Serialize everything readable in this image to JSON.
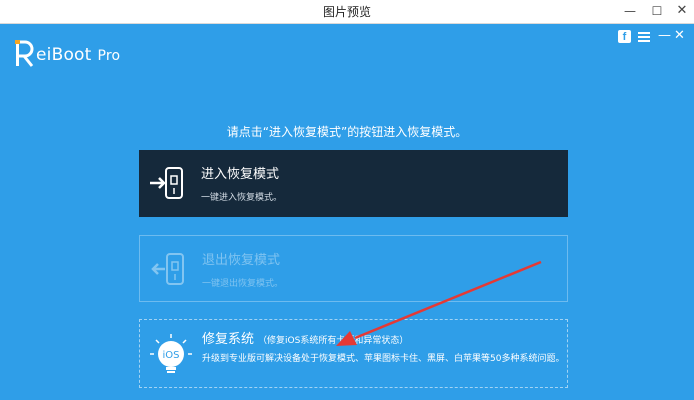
{
  "window": {
    "title": "图片预览",
    "min": "—",
    "max": "☐",
    "close": "✕"
  },
  "app": {
    "logo_name": "eiBoot",
    "logo_suffix": "Pro",
    "facebook": "f",
    "min": "—",
    "close": "✕"
  },
  "instruction": "请点击“进入恢复模式”的按钮进入恢复模式。",
  "cards": [
    {
      "title": "进入恢复模式",
      "subtitle": "一键进入恢复模式。"
    },
    {
      "title": "退出恢复模式",
      "subtitle": "一键退出恢复模式。"
    },
    {
      "title": "修复系统",
      "tag": "（修复iOS系统所有卡顿和异常状态）",
      "subtitle": "升级到专业版可解决设备处于恢复模式、苹果图标卡住、黑屏、白苹果等50多种系统问题。",
      "icon_label": "iOS"
    }
  ],
  "colors": {
    "background": "#2f9ee8",
    "card_dark": "#15293b",
    "annotation_arrow": "#e53935"
  }
}
